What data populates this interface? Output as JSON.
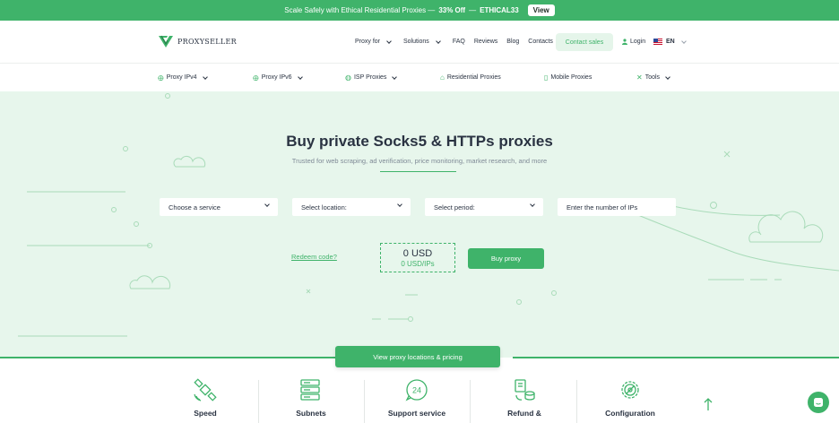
{
  "promo": {
    "text": "Scale Safely with Ethical Residential Proxies —",
    "discount": "33% Off",
    "dash": "—",
    "code": "ETHICAL33",
    "view_label": "View"
  },
  "header": {
    "logo_text": "PROXYSELLER",
    "nav": [
      {
        "label": "Proxy for"
      },
      {
        "label": "Solutions"
      },
      {
        "label": "FAQ"
      },
      {
        "label": "Reviews"
      },
      {
        "label": "Blog"
      },
      {
        "label": "Contacts"
      }
    ],
    "contact_sales": "Contact sales",
    "login": "Login",
    "language": "EN"
  },
  "subnav": [
    {
      "label": "Proxy IPv4",
      "icon": "globe-icon"
    },
    {
      "label": "Proxy IPv6",
      "icon": "globe-icon"
    },
    {
      "label": "ISP Proxies",
      "icon": "isp-icon"
    },
    {
      "label": "Residential Proxies",
      "icon": "home-icon"
    },
    {
      "label": "Mobile Proxies",
      "icon": "mobile-icon"
    },
    {
      "label": "Tools",
      "icon": "tools-icon"
    }
  ],
  "hero": {
    "title": "Buy private Socks5 & HTTPs proxies",
    "subtitle": "Trusted for web scraping, ad verification, price monitoring, market research, and more",
    "selects": {
      "service": "Choose a service",
      "location": "Select location:",
      "period": "Select period:",
      "ips_placeholder": "Enter the number of IPs"
    },
    "redeem": "Redeem code?",
    "price": "0 USD",
    "price_per_ip": "0 USD/IPs",
    "buy_label": "Buy proxy"
  },
  "view_locations": "View proxy locations & pricing",
  "features": [
    {
      "label": "Speed",
      "icon": "satellite-icon"
    },
    {
      "label": "Subnets",
      "icon": "server-icon"
    },
    {
      "label": "Support service",
      "icon": "support-24-icon"
    },
    {
      "label": "Refund &",
      "icon": "refund-icon"
    },
    {
      "label": "Configuration",
      "icon": "gear-icon"
    }
  ],
  "colors": {
    "brand_green": "#3fb36a",
    "hero_background": "#e7f6ec",
    "text_dark": "#2a3342"
  }
}
